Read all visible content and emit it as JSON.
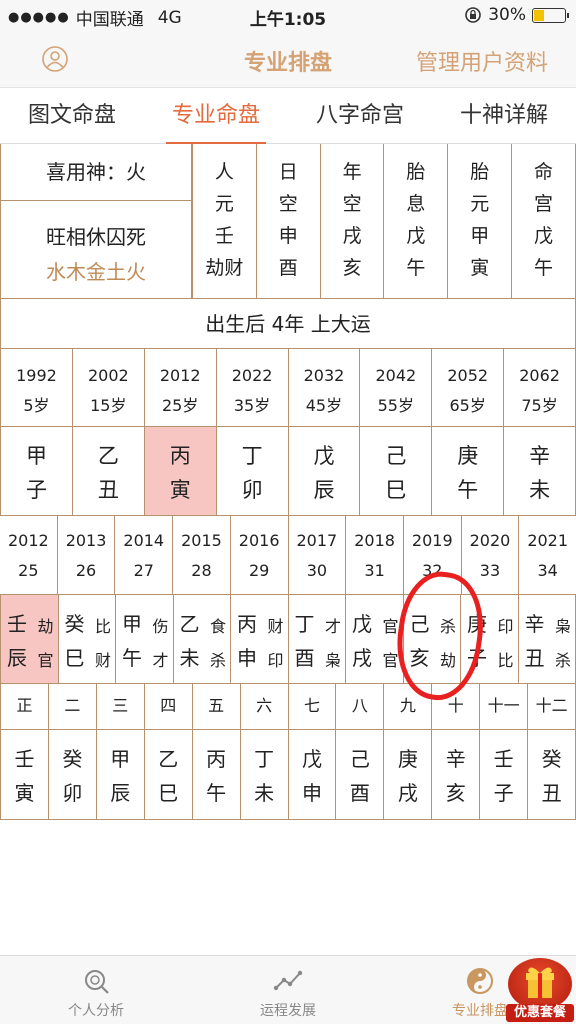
{
  "status": {
    "signal": "●●●●●",
    "carrier": "中国联通",
    "network": "4G",
    "time": "上午1:05",
    "battery": "30%",
    "battery_level": 0.3
  },
  "nav": {
    "title": "专业排盘",
    "manage": "管理用户资料"
  },
  "tabs": [
    {
      "label": "图文命盘",
      "active": false
    },
    {
      "label": "专业命盘",
      "active": true
    },
    {
      "label": "八字命宫",
      "active": false
    },
    {
      "label": "十神详解",
      "active": false
    }
  ],
  "info": {
    "xiyong": "喜用神：火",
    "wangxiang": "旺相休囚死",
    "wuxing": "水木金土火",
    "columns": [
      [
        "人",
        "元",
        "壬",
        "劫财"
      ],
      [
        "日",
        "空",
        "申",
        "酉"
      ],
      [
        "年",
        "空",
        "戌",
        "亥"
      ],
      [
        "胎",
        "息",
        "戊",
        "午"
      ],
      [
        "胎",
        "元",
        "甲",
        "寅"
      ],
      [
        "命",
        "宫",
        "戊",
        "午"
      ]
    ]
  },
  "dayun": {
    "start": "出生后 4年 上大运",
    "years": [
      {
        "year": "1992",
        "age": "5岁"
      },
      {
        "year": "2002",
        "age": "15岁"
      },
      {
        "year": "2012",
        "age": "25岁"
      },
      {
        "year": "2022",
        "age": "35岁"
      },
      {
        "year": "2032",
        "age": "45岁"
      },
      {
        "year": "2042",
        "age": "55岁"
      },
      {
        "year": "2052",
        "age": "65岁"
      },
      {
        "year": "2062",
        "age": "75岁"
      }
    ],
    "ganzhi": [
      {
        "gan": "甲",
        "zhi": "子"
      },
      {
        "gan": "乙",
        "zhi": "丑"
      },
      {
        "gan": "丙",
        "zhi": "寅",
        "highlight": true
      },
      {
        "gan": "丁",
        "zhi": "卯"
      },
      {
        "gan": "戊",
        "zhi": "辰"
      },
      {
        "gan": "己",
        "zhi": "巳"
      },
      {
        "gan": "庚",
        "zhi": "午"
      },
      {
        "gan": "辛",
        "zhi": "未"
      }
    ]
  },
  "liunian": {
    "years": [
      {
        "year": "2012",
        "age": "25"
      },
      {
        "year": "2013",
        "age": "26"
      },
      {
        "year": "2014",
        "age": "27"
      },
      {
        "year": "2015",
        "age": "28"
      },
      {
        "year": "2016",
        "age": "29"
      },
      {
        "year": "2017",
        "age": "30"
      },
      {
        "year": "2018",
        "age": "31"
      },
      {
        "year": "2019",
        "age": "32"
      },
      {
        "year": "2020",
        "age": "33"
      },
      {
        "year": "2021",
        "age": "34"
      }
    ],
    "ganzhi": [
      {
        "gan": "壬",
        "zhi": "辰",
        "s1": "劫",
        "s2": "官",
        "highlight": true
      },
      {
        "gan": "癸",
        "zhi": "巳",
        "s1": "比",
        "s2": "财"
      },
      {
        "gan": "甲",
        "zhi": "午",
        "s1": "伤",
        "s2": "才"
      },
      {
        "gan": "乙",
        "zhi": "未",
        "s1": "食",
        "s2": "杀"
      },
      {
        "gan": "丙",
        "zhi": "申",
        "s1": "财",
        "s2": "印"
      },
      {
        "gan": "丁",
        "zhi": "酉",
        "s1": "才",
        "s2": "枭"
      },
      {
        "gan": "戊",
        "zhi": "戌",
        "s1": "官",
        "s2": "官"
      },
      {
        "gan": "己",
        "zhi": "亥",
        "s1": "杀",
        "s2": "劫"
      },
      {
        "gan": "庚",
        "zhi": "子",
        "s1": "印",
        "s2": "比"
      },
      {
        "gan": "辛",
        "zhi": "丑",
        "s1": "枭",
        "s2": "杀"
      }
    ]
  },
  "months": {
    "labels": [
      "正",
      "二",
      "三",
      "四",
      "五",
      "六",
      "七",
      "八",
      "九",
      "十",
      "十一",
      "十二"
    ],
    "ganzhi": [
      {
        "gan": "壬",
        "zhi": "寅"
      },
      {
        "gan": "癸",
        "zhi": "卯"
      },
      {
        "gan": "甲",
        "zhi": "辰"
      },
      {
        "gan": "乙",
        "zhi": "巳"
      },
      {
        "gan": "丙",
        "zhi": "午"
      },
      {
        "gan": "丁",
        "zhi": "未"
      },
      {
        "gan": "戊",
        "zhi": "申"
      },
      {
        "gan": "己",
        "zhi": "酉"
      },
      {
        "gan": "庚",
        "zhi": "戌"
      },
      {
        "gan": "辛",
        "zhi": "亥"
      },
      {
        "gan": "壬",
        "zhi": "子"
      },
      {
        "gan": "癸",
        "zhi": "丑"
      }
    ]
  },
  "bottom": {
    "items": [
      {
        "label": "个人分析",
        "icon": "search-icon",
        "active": false
      },
      {
        "label": "运程发展",
        "icon": "trend-icon",
        "active": false
      },
      {
        "label": "专业排盘",
        "icon": "yinyang-icon",
        "active": true
      }
    ],
    "promo": "优惠套餐"
  },
  "colors": {
    "accent": "#e36b3e",
    "gold": "#d4a274",
    "border": "#b5916d",
    "highlight": "#f7c6c3",
    "annotation": "#e8201f"
  }
}
